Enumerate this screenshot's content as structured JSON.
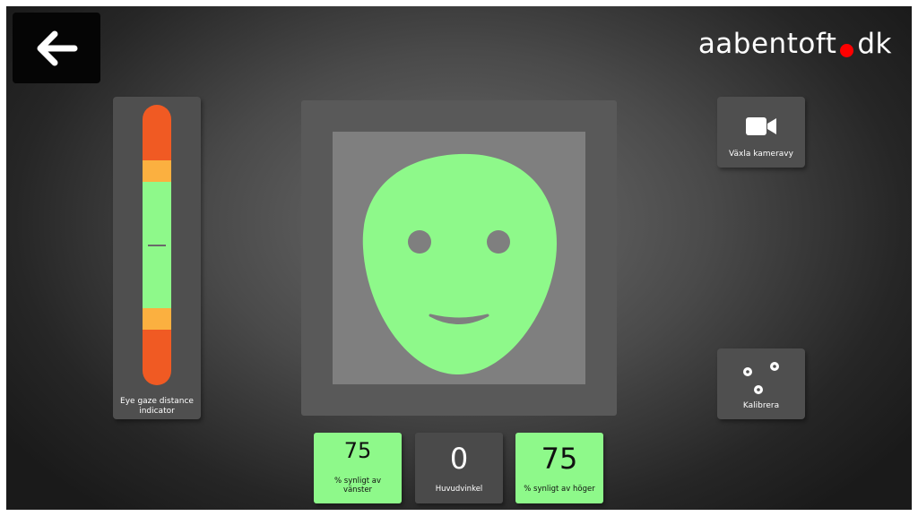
{
  "logo": {
    "text_left": "aabentoft",
    "text_right": "dk"
  },
  "back": {
    "icon": "arrow-left-icon"
  },
  "gauge": {
    "label": "Eye gaze distance indicator",
    "level": 0.5,
    "colors": {
      "red": "#f05a23",
      "orange": "#fbb040",
      "green": "#8ef98a"
    }
  },
  "face": {
    "color": "#8ef98a",
    "status": "good"
  },
  "camera_button": {
    "label": "Växla kameravy",
    "icon": "video-camera-icon"
  },
  "calibrate_button": {
    "label": "Kalibrera",
    "icon": "calibration-dots-icon"
  },
  "stats": {
    "left": {
      "value": "75",
      "label": "% synligt av vänster"
    },
    "angle": {
      "value": "0",
      "label": "Huvudvinkel"
    },
    "right": {
      "value": "75",
      "label": "% synligt av höger"
    }
  }
}
